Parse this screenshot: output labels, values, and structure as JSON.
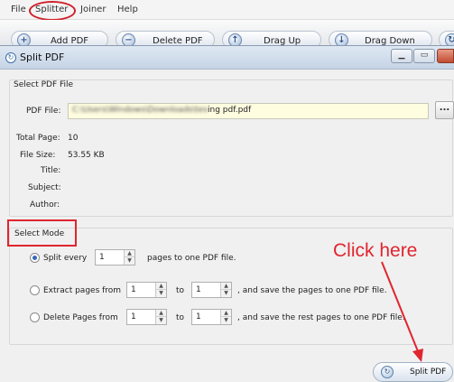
{
  "menu": {
    "items": [
      {
        "label": "File"
      },
      {
        "label": "Splitter"
      },
      {
        "label": "Joiner"
      },
      {
        "label": "Help"
      }
    ]
  },
  "toolbar": {
    "add_pdf": "Add PDF",
    "delete_pdf": "Delete PDF",
    "drag_up": "Drag Up",
    "drag_down": "Drag Down"
  },
  "dialog": {
    "title": "Split PDF",
    "select_file": {
      "section_title": "Select PDF File",
      "pdf_file_label": "PDF File:",
      "path_hidden": "C:\\Users\\Windows\\Downloads\\tes",
      "path_visible": "ing pdf.pdf",
      "browse_label": "..."
    },
    "info": {
      "total_page_label": "Total Page:",
      "total_page_value": "10",
      "file_size_label": "File Size:",
      "file_size_value": "53.55 KB",
      "title_label": "Title:",
      "subject_label": "Subject:",
      "author_label": "Author:"
    },
    "mode": {
      "section_title": "Select Mode",
      "split_every_label": "Split every",
      "split_every_value": "1",
      "split_every_suffix": "pages to one PDF file.",
      "extract_label": "Extract pages  from",
      "extract_from": "1",
      "extract_to_label": "to",
      "extract_to": "1",
      "extract_suffix": ", and save the pages to one PDF file.",
      "delete_label": "Delete Pages  from",
      "delete_from": "1",
      "delete_to_label": "to",
      "delete_to": "1",
      "delete_suffix": ", and save the rest pages to one PDF file."
    },
    "split_button": "Split PDF"
  },
  "annotation": {
    "text": "Click here",
    "color": "#e0252f"
  }
}
